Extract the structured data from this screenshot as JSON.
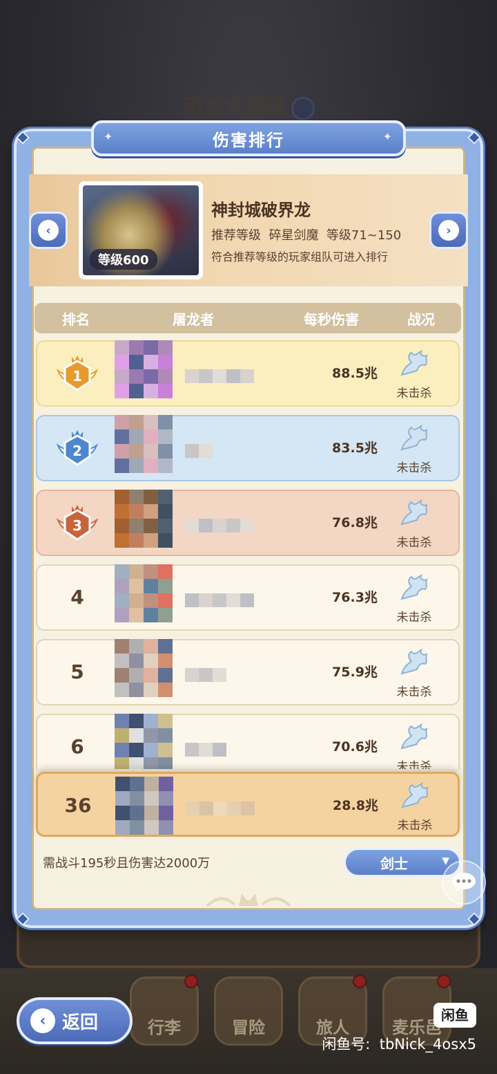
{
  "background": {
    "title": "恐龙大通缉",
    "nav": [
      "行李",
      "冒险",
      "旅人",
      "麦乐邑"
    ]
  },
  "modal": {
    "title": "伤害排行",
    "boss": {
      "name": "神封城破界龙",
      "level_tag": "等级600",
      "recommend": "推荐等级  碎星剑魔  等级71~150",
      "note": "符合推荐等级的玩家组队可进入排行"
    },
    "columns": [
      "排名",
      "屠龙者",
      "每秒伤害",
      "战况"
    ],
    "rows": [
      {
        "rank": "1",
        "dps": "88.5兆",
        "status": "未击杀"
      },
      {
        "rank": "2",
        "dps": "83.5兆",
        "status": "未击杀"
      },
      {
        "rank": "3",
        "dps": "76.8兆",
        "status": "未击杀"
      },
      {
        "rank": "4",
        "dps": "76.3兆",
        "status": "未击杀"
      },
      {
        "rank": "5",
        "dps": "75.9兆",
        "status": "未击杀"
      },
      {
        "rank": "6",
        "dps": "70.6兆",
        "status": "未击杀"
      }
    ],
    "self_row": {
      "rank": "36",
      "dps": "28.8兆",
      "status": "未击杀"
    },
    "requirement": "需战斗195秒且伤害达2000万",
    "class_select": "剑士"
  },
  "back_button": "返回",
  "watermark": {
    "badge": "闲鱼",
    "text": "闲鱼号:  tbNick_4osx5"
  },
  "colors": {
    "rank1_bg": "#fbefc0",
    "rank2_bg": "#d5e6f4",
    "rank3_bg": "#f4d6c4",
    "row_bg": "#fcf7ea",
    "self_bg": "#f5d3a0",
    "accent_blue": "#5b80c9"
  }
}
